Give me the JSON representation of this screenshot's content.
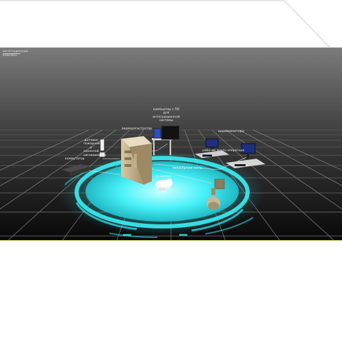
{
  "logo": {
    "line1": "ИНТЕГРАЦИОННЫЙ",
    "line2": "КОМПЛЕКС"
  },
  "labels": {
    "videoregistrator": "видеорегистратор",
    "monitor_po": "компьютер с ПО для интеграционной системы",
    "videomonitors": "видеомониторы",
    "ip_camera": "ip-камера",
    "sensors": "датчики пожарной и охранной сигнализации",
    "switch": "коммутатор",
    "workplace": "рабочее место оператора",
    "network": "локальная сеть"
  },
  "colors": {
    "platform": "#3af0f6",
    "glow": "#7ffcff",
    "grid": "#8a8a8a",
    "frame": "#c7c75a"
  }
}
